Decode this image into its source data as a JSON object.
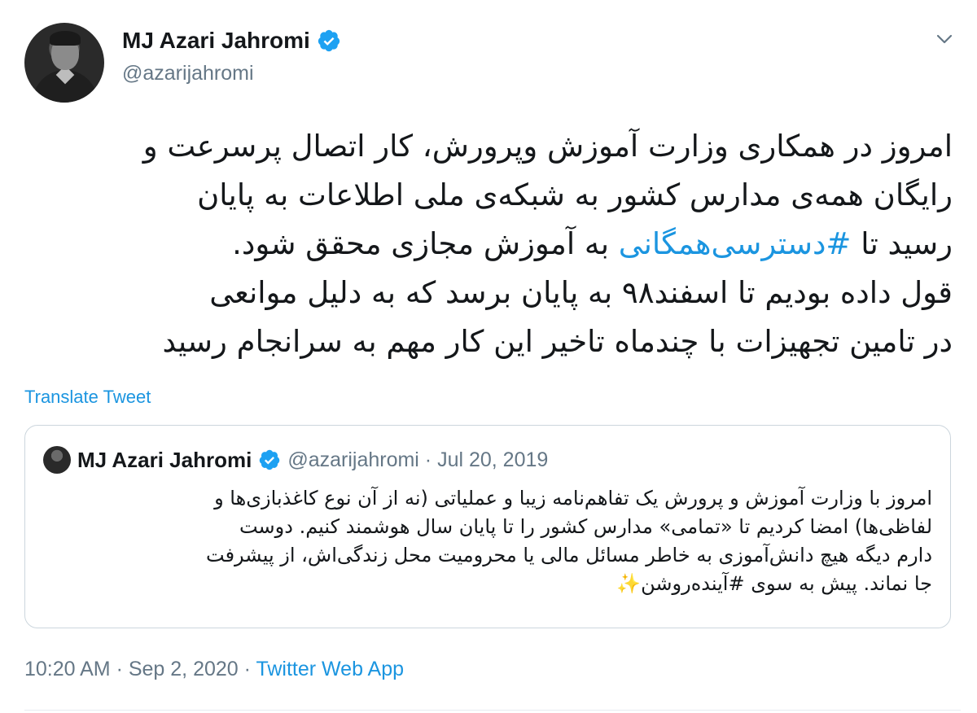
{
  "author": {
    "display_name": "MJ Azari Jahromi",
    "handle": "@azarijahromi",
    "avatar": "profile-photo",
    "verified_icon": "verified-badge-icon",
    "menu_icon": "chevron-down-icon"
  },
  "tweet": {
    "lines": [
      "امروز در همکاری وزارت آموزش وپرورش، کار اتصال پرسرعت و",
      "رایگان همه‌ی مدارس کشور به شبکه‌ی ملی اطلاعات به پایان",
      {
        "before": "رسید تا ",
        "hashtag": "#دسترسی‌همگانی",
        "after": " به آموزش مجازی محقق شود."
      },
      "قول داده بودیم تا اسفند۹۸ به پایان برسد که به دلیل موانعی",
      "در تامین تجهیزات با چندماه تاخیر این کار مهم به سرانجام رسید"
    ],
    "translate_label": "Translate Tweet",
    "timestamp": "10:20 AM · Sep 2, 2020 · ",
    "source": "Twitter Web App"
  },
  "quoted_tweet": {
    "display_name": "MJ Azari Jahromi",
    "handle_date": "@azarijahromi · Jul 20, 2019",
    "lines": [
      "امروز با وزارت آموزش و پرورش یک تفاهم‌نامه زیبا و عملیاتی (نه از آن نوع کاغذبازی‌ها و",
      "لفاظی‌ها) امضا کردیم تا «تمامی» مدارس کشور را تا پایان سال هوشمند کنیم. دوست",
      "دارم دیگه هیچ دانش‌آموزی به خاطر مسائل مالی یا محرومیت محل زندگی‌اش، از پیشرفت",
      "جا نماند. پیش به سوی #آینده‌روشن"
    ],
    "emoji": "✨"
  },
  "colors": {
    "accent": "#1b95e0",
    "text": "#14171a",
    "muted": "#657786",
    "border": "#ccd6dd"
  }
}
